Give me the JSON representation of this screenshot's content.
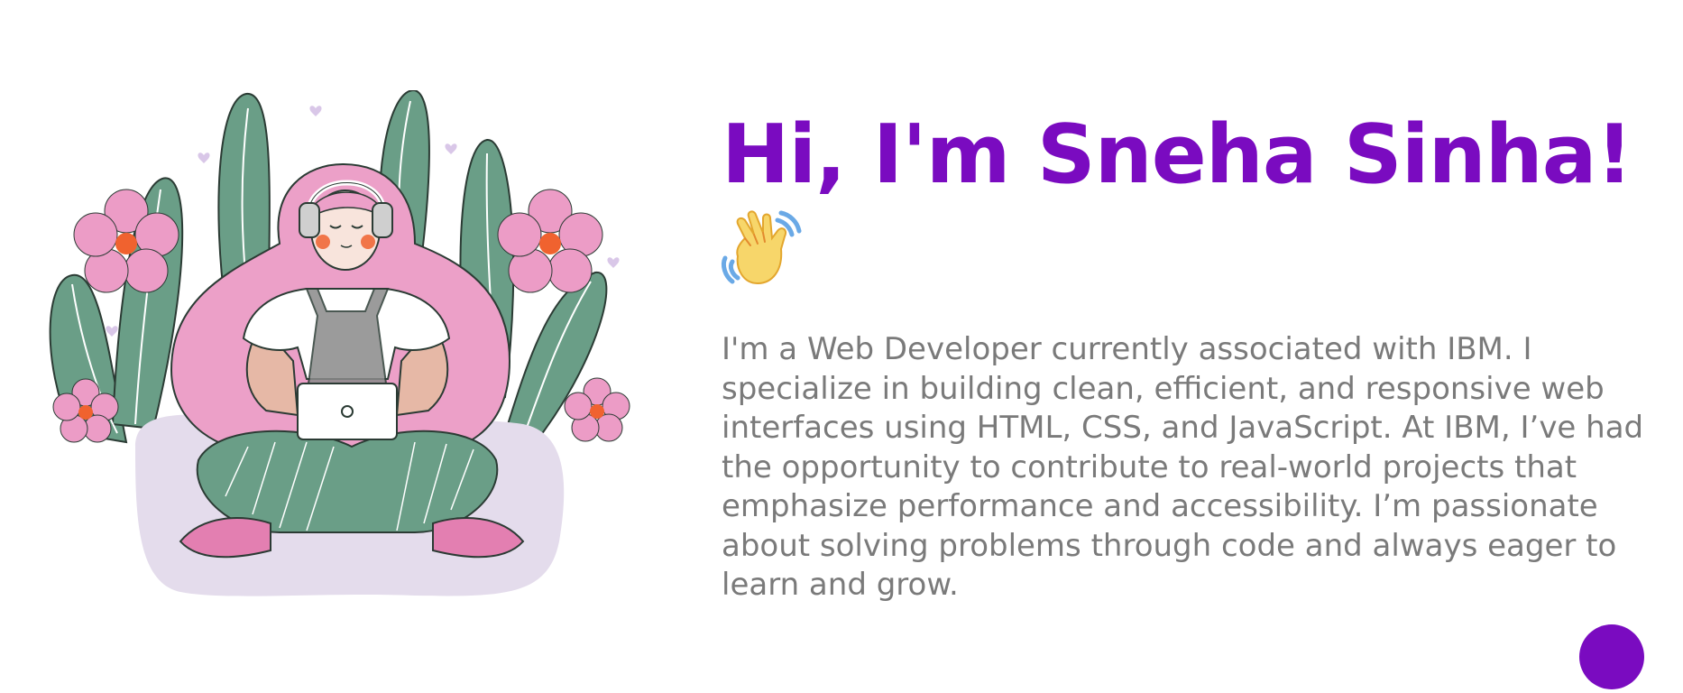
{
  "hero": {
    "title": "Hi, I'm Sneha Sinha!",
    "wave_icon": "waving-hand-icon",
    "description": "I'm a Web Developer currently associated with IBM. I specialize in building clean, efficient, and responsive web interfaces using HTML, CSS, and JavaScript. At IBM, I’ve had the opportunity to contribute to real-world projects that emphasize performance and accessibility. I’m passionate about solving problems through code and always eager to learn and grow."
  },
  "illustration": {
    "subject": "girl-with-laptop-illustration"
  },
  "floating_button": {
    "icon": "circle-button"
  },
  "colors": {
    "accent": "#7a0bc0",
    "text": "#7a7a7a",
    "leaf": "#6a9e87",
    "hair": "#eca0c8",
    "flower": "#ec9cc6",
    "flower_center": "#f0622f",
    "cushion": "#e4dcec",
    "hand": "#f7d66a",
    "wave_lines": "#6aa9e6"
  }
}
